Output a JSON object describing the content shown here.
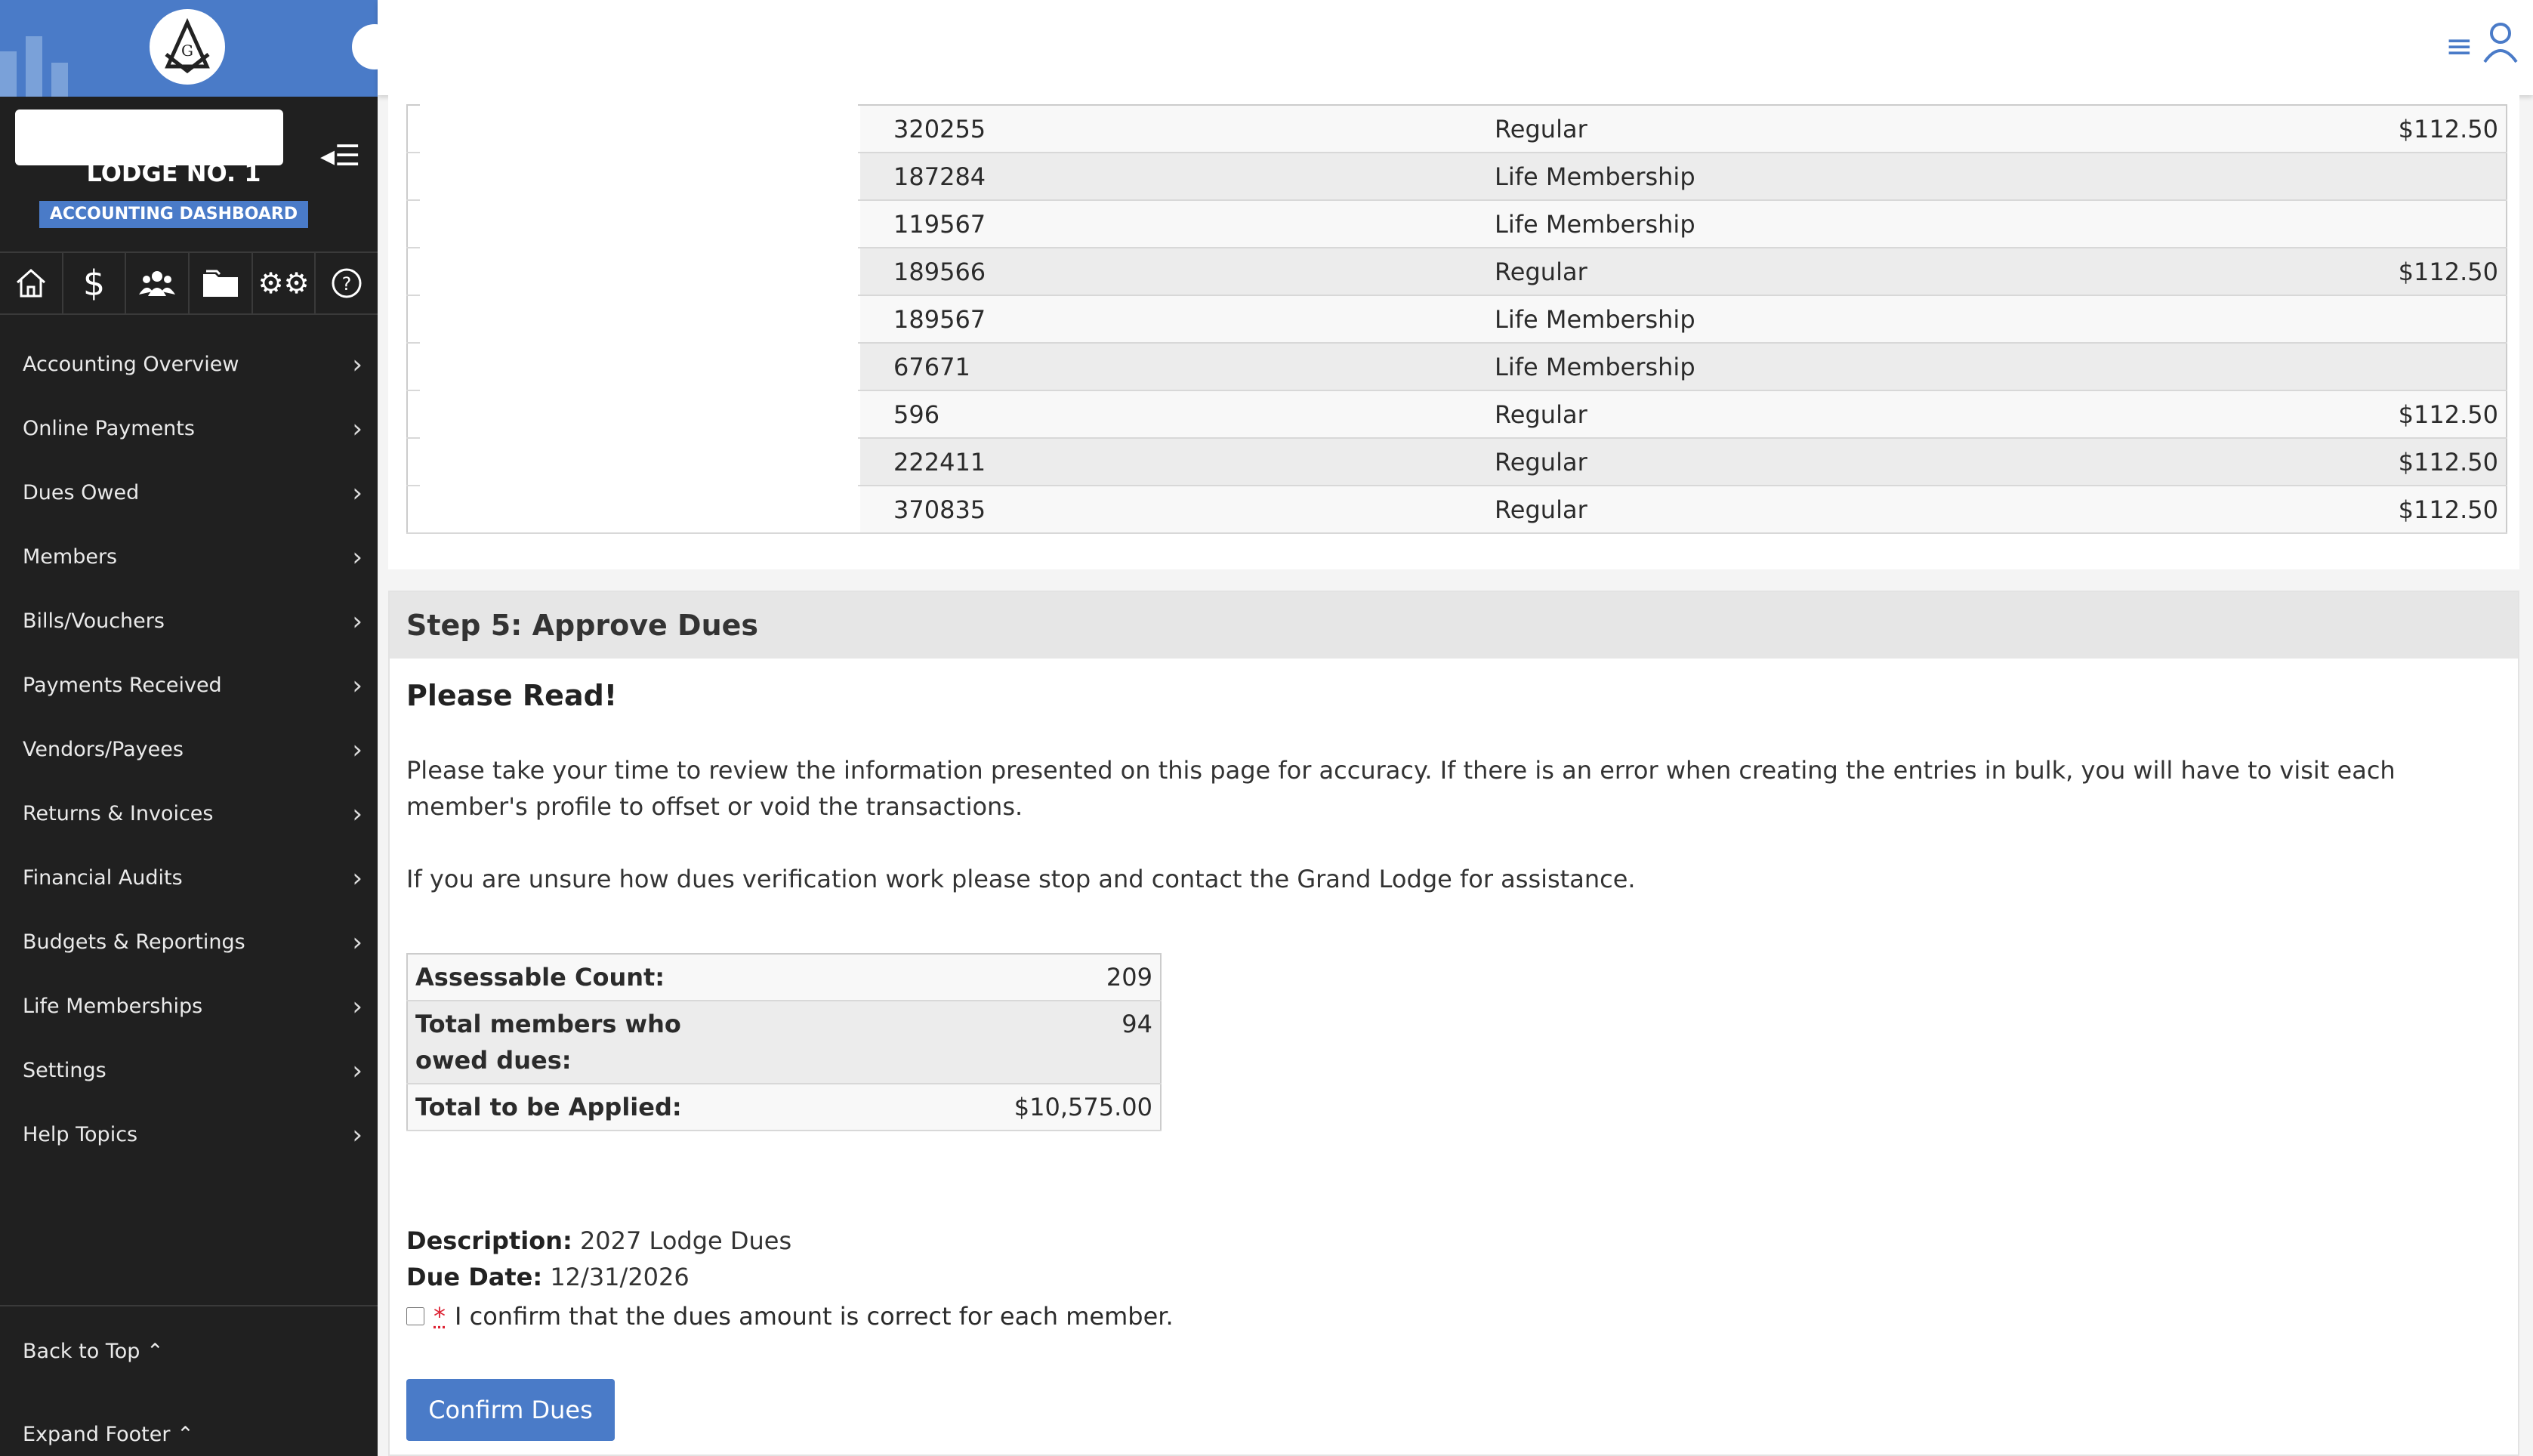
{
  "sidebar": {
    "lodge_name": "LODGE NO. 1",
    "dashboard_badge": "ACCOUNTING DASHBOARD",
    "icons": [
      "home-icon",
      "dollar-icon",
      "members-icon",
      "folder-icon",
      "gears-icon",
      "help-icon"
    ],
    "items": [
      {
        "label": "Accounting Overview"
      },
      {
        "label": "Online Payments"
      },
      {
        "label": "Dues Owed"
      },
      {
        "label": "Members"
      },
      {
        "label": "Bills/Vouchers"
      },
      {
        "label": "Payments Received"
      },
      {
        "label": "Vendors/Payees"
      },
      {
        "label": "Returns & Invoices"
      },
      {
        "label": "Financial Audits"
      },
      {
        "label": "Budgets & Reportings"
      },
      {
        "label": "Life Memberships"
      },
      {
        "label": "Settings"
      },
      {
        "label": "Help Topics"
      }
    ],
    "back_to_top": "Back to Top",
    "expand_footer": "Expand Footer"
  },
  "colors": {
    "accent": "#4a7bc8",
    "sidebar_bg": "#202020"
  },
  "dues_table": {
    "rows": [
      {
        "id": "320255",
        "type": "Regular",
        "amount": "$112.50"
      },
      {
        "id": "187284",
        "type": "Life Membership",
        "amount": ""
      },
      {
        "id": "119567",
        "type": "Life Membership",
        "amount": ""
      },
      {
        "id": "189566",
        "type": "Regular",
        "amount": "$112.50"
      },
      {
        "id": "189567",
        "type": "Life Membership",
        "amount": ""
      },
      {
        "id": "67671",
        "type": "Life Membership",
        "amount": ""
      },
      {
        "id": "596",
        "type": "Regular",
        "amount": "$112.50"
      },
      {
        "id": "222411",
        "type": "Regular",
        "amount": "$112.50"
      },
      {
        "id": "370835",
        "type": "Regular",
        "amount": "$112.50"
      }
    ]
  },
  "step5": {
    "title": "Step 5: Approve Dues",
    "please_read": "Please Read!",
    "para1": "Please take your time to review the information presented on this page for accuracy. If there is an error when creating the entries in bulk, you will have to visit each member's profile to offset or void the transactions.",
    "para2": "If you are unsure how dues verification work please stop and contact the Grand Lodge for assistance.",
    "summary": {
      "assessable_label": "Assessable Count:",
      "assessable_value": "209",
      "owed_label": "Total members who owed dues:",
      "owed_value": "94",
      "total_label": "Total to be Applied:",
      "total_value": "$10,575.00"
    },
    "description_label": "Description:",
    "description_value": "2027 Lodge Dues",
    "due_date_label": "Due Date:",
    "due_date_value": "12/31/2026",
    "required_mark": "*",
    "confirm_text": "I confirm that the dues amount is correct for each member.",
    "confirm_button": "Confirm Dues"
  }
}
